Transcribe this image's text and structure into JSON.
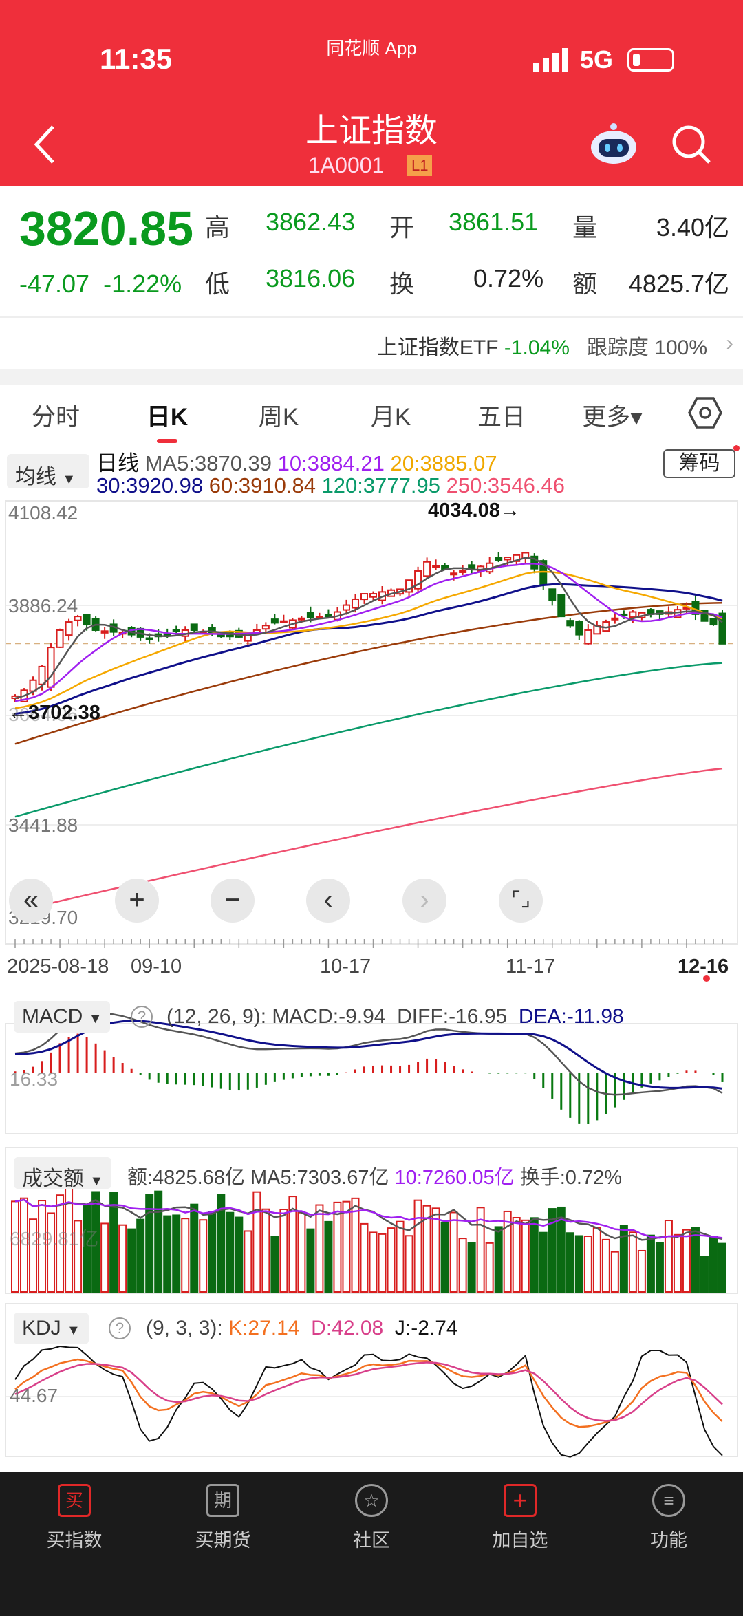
{
  "status": {
    "time": "11:35",
    "app": "同花顺 App",
    "network": "5G"
  },
  "header": {
    "title": "上证指数",
    "code": "1A0001",
    "level": "L1"
  },
  "quote": {
    "price": "3820.85",
    "change": "-47.07",
    "change_pct": "-1.22%",
    "high_label": "高",
    "high": "3862.43",
    "low_label": "低",
    "low": "3816.06",
    "open_label": "开",
    "open": "3861.51",
    "turnover_label": "换",
    "turnover": "0.72%",
    "volume_label": "量",
    "volume": "3.40亿",
    "amount_label": "额",
    "amount": "4825.7亿"
  },
  "etf": {
    "name": "上证指数ETF",
    "change": "-1.04%",
    "track_label": "跟踪度",
    "track": "100%"
  },
  "tabs": [
    "分时",
    "日K",
    "周K",
    "月K",
    "五日",
    "更多▾"
  ],
  "ma": {
    "selector": "均线",
    "period": "日线",
    "ma5": "MA5:3870.39",
    "ma10": "10:3884.21",
    "ma20": "20:3885.07",
    "ma30": "30:3920.98",
    "ma60": "60:3910.84",
    "ma120": "120:3777.95",
    "ma250": "250:3546.46",
    "chip_button": "筹码",
    "colors": {
      "ma5": "#555555",
      "ma10": "#a020f0",
      "ma20": "#f5a800",
      "ma30": "#10108a",
      "ma60": "#9a3b0a",
      "ma120": "#0a9a6a",
      "ma250": "#ef5070"
    }
  },
  "kline": {
    "y_labels": [
      "4108.42",
      "3886.24",
      "3664.06",
      "3441.88",
      "3219.70"
    ],
    "high_mark": "4034.08→",
    "low_mark": "←3702.38",
    "dates": [
      "2025-08-18",
      "09-10",
      "10-17",
      "11-17",
      "12-16"
    ],
    "closes": [
      3705,
      3718,
      3740,
      3770,
      3812,
      3850,
      3868,
      3880,
      3862,
      3850,
      3848,
      3846,
      3845,
      3840,
      3835,
      3830,
      3836,
      3842,
      3848,
      3850,
      3850,
      3846,
      3842,
      3838,
      3836,
      3835,
      3842,
      3850,
      3860,
      3866,
      3870,
      3872,
      3876,
      3878,
      3880,
      3880,
      3890,
      3905,
      3918,
      3930,
      3930,
      3934,
      3938,
      3940,
      3960,
      3980,
      4000,
      3992,
      3984,
      3975,
      3980,
      3985,
      3990,
      3997,
      4004,
      4010,
      4015,
      4020,
      3985,
      3950,
      3915,
      3880,
      3860,
      3840,
      3850,
      3860,
      3868,
      3876,
      3884,
      3890,
      3888,
      3886,
      3885,
      3890,
      3895,
      3900,
      3885,
      3870,
      3862,
      3820
    ]
  },
  "macd": {
    "selector": "MACD",
    "params": "(12, 26, 9):",
    "macd": "MACD:-9.94",
    "diff": "DIFF:-16.95",
    "dea": "DEA:-11.98",
    "axis": "16.33"
  },
  "vol": {
    "selector": "成交额",
    "amount": "额:4825.68亿",
    "ma5": "MA5:7303.67亿",
    "ma10": "10:7260.05亿",
    "turnover": "换手:0.72%",
    "axis": "6829.81亿"
  },
  "kdj": {
    "selector": "KDJ",
    "params": "(9, 3, 3):",
    "k": "K:27.14",
    "d": "D:42.08",
    "j": "J:-2.74",
    "axis": "44.67"
  },
  "nav": [
    {
      "icon": "买",
      "label": "买指数"
    },
    {
      "icon": "期",
      "label": "买期货"
    },
    {
      "icon": "☆",
      "label": "社区"
    },
    {
      "icon": "+",
      "label": "加自选"
    },
    {
      "icon": "≡",
      "label": "功能"
    }
  ]
}
